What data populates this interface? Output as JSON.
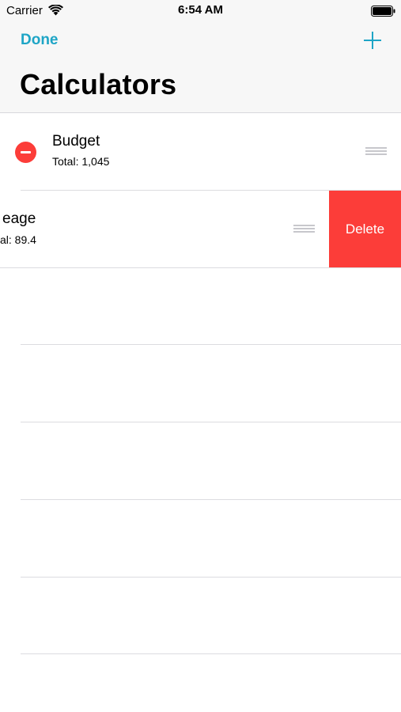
{
  "status_bar": {
    "carrier": "Carrier",
    "time": "6:54 AM",
    "wifi_icon": "wifi-icon",
    "battery_icon": "battery-full-icon"
  },
  "nav": {
    "done_label": "Done",
    "add_icon": "plus-icon",
    "title": "Calculators"
  },
  "rows": [
    {
      "title": "Budget",
      "subtitle": "Total: 1,045",
      "delete_control_icon": "minus-circle-icon",
      "reorder_icon": "reorder-handle-icon"
    },
    {
      "title": "eage",
      "subtitle": "al: 89.4",
      "reorder_icon": "reorder-handle-icon",
      "delete_label": "Delete"
    }
  ],
  "colors": {
    "accent": "#1ea5c6",
    "destructive": "#fc3d39",
    "separator": "#dcdce0"
  }
}
